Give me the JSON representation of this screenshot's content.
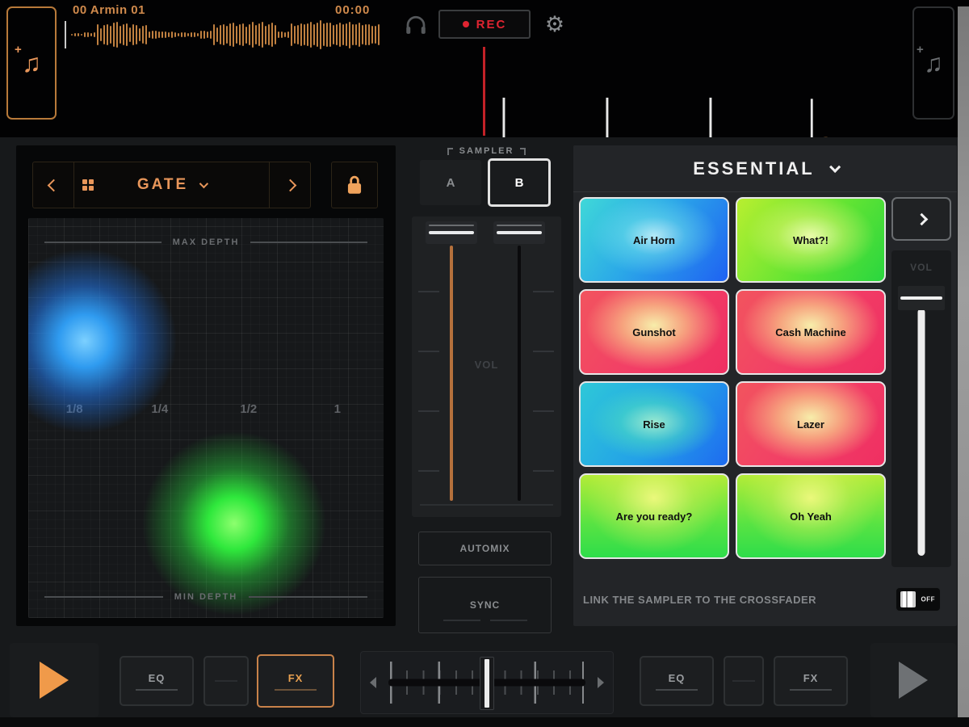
{
  "colors": {
    "accent_orange": "#e8965a",
    "rec_red": "#e02431",
    "waveform_orange": "#c08040",
    "pad_border": "#e6e6e6",
    "blob_blue": "#2f9bf0",
    "blob_green": "#2fe83c"
  },
  "top_bar": {
    "track_title": "00 Armin 01",
    "elapsed_time": "00:00",
    "rec_label": "REC",
    "icons": {
      "add_track_left": "music-note-plus-icon",
      "headphones": "headphones-icon",
      "settings": "gear-icon",
      "add_track_right": "music-note-plus-icon"
    }
  },
  "fx_panel": {
    "effect_name": "GATE",
    "top_label": "MAX DEPTH",
    "bottom_label": "MIN DEPTH",
    "beat_fractions": [
      "1/8",
      "1/4",
      "1/2",
      "1"
    ]
  },
  "sampler_column": {
    "section_label": "SAMPLER",
    "tabs": [
      {
        "label": "A",
        "selected": false
      },
      {
        "label": "B",
        "selected": true
      }
    ],
    "volume_label": "VOL",
    "automix_label": "AUTOMIX",
    "sync_label": "SYNC"
  },
  "sample_bank": {
    "bank_name": "ESSENTIAL",
    "pads": [
      {
        "label": "Air Horn",
        "color": "cyan-blue"
      },
      {
        "label": "What?!",
        "color": "green"
      },
      {
        "label": "Gunshot",
        "color": "red"
      },
      {
        "label": "Cash Machine",
        "color": "red"
      },
      {
        "label": "Rise",
        "color": "teal"
      },
      {
        "label": "Lazer",
        "color": "red"
      },
      {
        "label": "Are you ready?",
        "color": "lime"
      },
      {
        "label": "Oh Yeah",
        "color": "lime"
      }
    ],
    "volume_label": "VOL",
    "link_text": "LINK THE SAMPLER TO THE CROSSFADER",
    "link_toggle_state": "OFF"
  },
  "bottom_bar": {
    "deck_a": {
      "eq_label": "EQ",
      "fx_label": "FX"
    },
    "deck_b": {
      "eq_label": "EQ",
      "fx_label": "FX"
    }
  }
}
